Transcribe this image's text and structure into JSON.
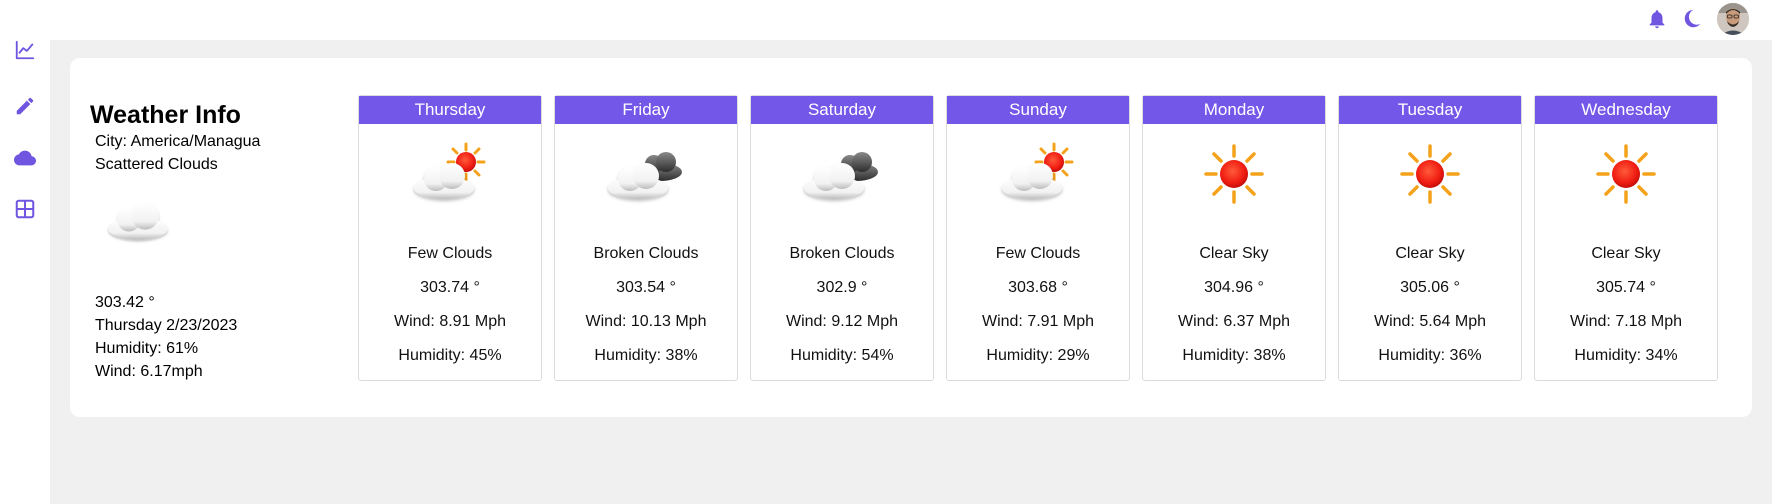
{
  "sidebar": {
    "items": [
      {
        "icon": "chart-line-icon"
      },
      {
        "icon": "pencil-icon"
      },
      {
        "icon": "cloud-icon"
      },
      {
        "icon": "grid-icon"
      }
    ]
  },
  "header": {
    "icons": [
      "bell-icon",
      "moon-icon"
    ],
    "avatar": "user-avatar"
  },
  "colors": {
    "accent": "#7357e8",
    "background": "#f0f0f0"
  },
  "weather": {
    "title": "Weather Info",
    "city": "City: America/Managua",
    "condition": "Scattered Clouds",
    "icon": "scattered-clouds-icon",
    "temp": "303.42 °",
    "date": "Thursday 2/23/2023",
    "humidity": "Humidity: 61%",
    "wind": "Wind: 6.17mph"
  },
  "forecast": [
    {
      "day": "Thursday",
      "icon": "few-clouds-icon",
      "condition": "Few Clouds",
      "temp": "303.74 °",
      "wind": "Wind: 8.91 Mph",
      "humidity": "Humidity: 45%"
    },
    {
      "day": "Friday",
      "icon": "broken-clouds-icon",
      "condition": "Broken Clouds",
      "temp": "303.54 °",
      "wind": "Wind: 10.13 Mph",
      "humidity": "Humidity: 38%"
    },
    {
      "day": "Saturday",
      "icon": "broken-clouds-icon",
      "condition": "Broken Clouds",
      "temp": "302.9 °",
      "wind": "Wind: 9.12 Mph",
      "humidity": "Humidity: 54%"
    },
    {
      "day": "Sunday",
      "icon": "few-clouds-icon",
      "condition": "Few Clouds",
      "temp": "303.68 °",
      "wind": "Wind: 7.91 Mph",
      "humidity": "Humidity: 29%"
    },
    {
      "day": "Monday",
      "icon": "clear-sky-icon",
      "condition": "Clear Sky",
      "temp": "304.96 °",
      "wind": "Wind: 6.37 Mph",
      "humidity": "Humidity: 38%"
    },
    {
      "day": "Tuesday",
      "icon": "clear-sky-icon",
      "condition": "Clear Sky",
      "temp": "305.06 °",
      "wind": "Wind: 5.64 Mph",
      "humidity": "Humidity: 36%"
    },
    {
      "day": "Wednesday",
      "icon": "clear-sky-icon",
      "condition": "Clear Sky",
      "temp": "305.74 °",
      "wind": "Wind: 7.18 Mph",
      "humidity": "Humidity: 34%"
    }
  ]
}
